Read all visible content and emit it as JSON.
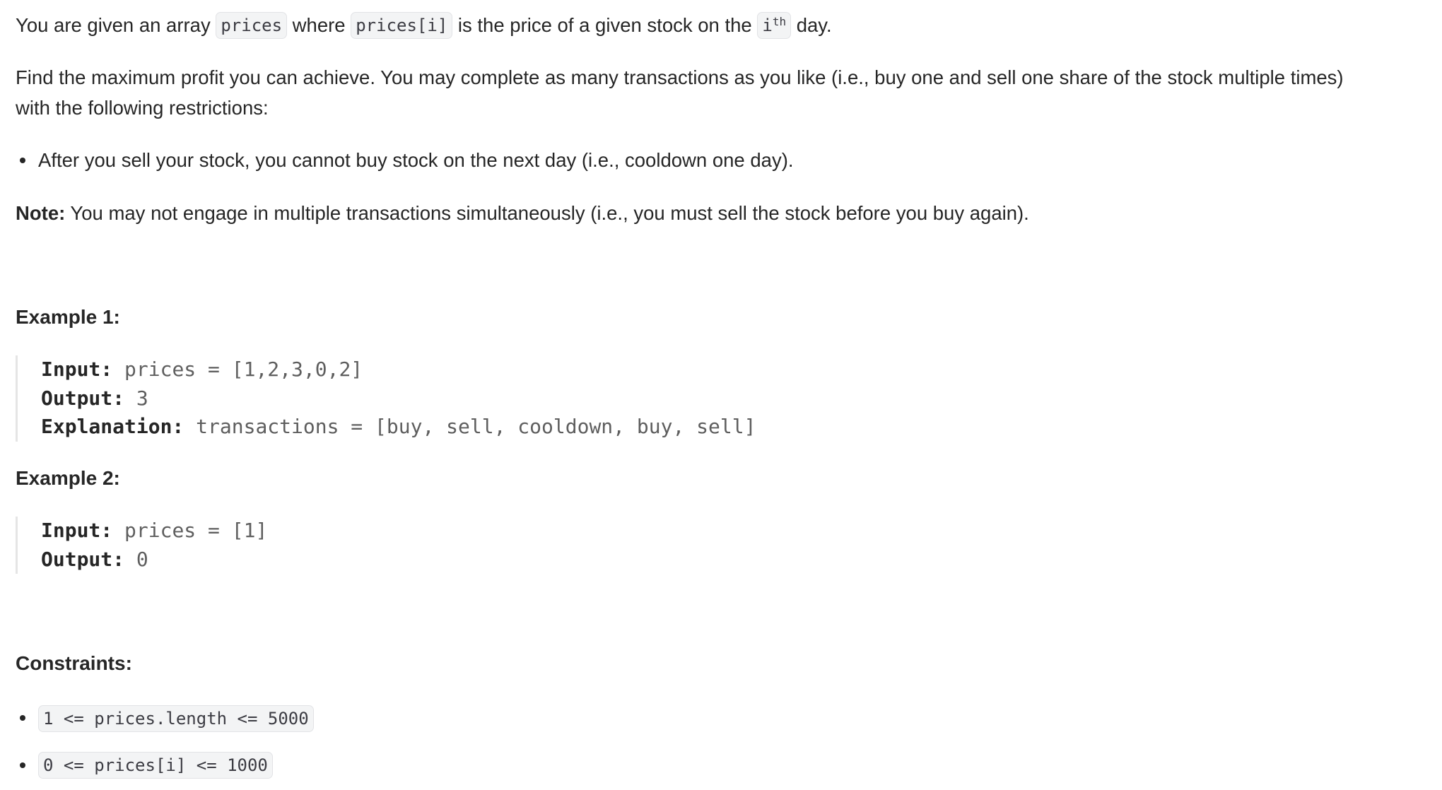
{
  "intro": {
    "t1": "You are given an array ",
    "c1": "prices",
    "t2": " where ",
    "c2": "prices[i]",
    "t3": " is the price of a given stock on the ",
    "c3_base": "i",
    "c3_sup": "th",
    "t4": " day."
  },
  "para2": {
    "line1": "Find the maximum profit you can achieve. You may complete as many transactions as you like (i.e., buy one and sell one share of the stock multiple times)",
    "line2": "with the following restrictions:"
  },
  "restrictions": [
    "After you sell your stock, you cannot buy stock on the next day (i.e., cooldown one day)."
  ],
  "note": {
    "label": "Note:",
    "text": " You may not engage in multiple transactions simultaneously (i.e., you must sell the stock before you buy again)."
  },
  "examples": [
    {
      "title": "Example 1:",
      "input_label": "Input:",
      "input_value": " prices = [1,2,3,0,2]",
      "output_label": "Output:",
      "output_value": " 3",
      "explanation_label": "Explanation:",
      "explanation_value": " transactions = [buy, sell, cooldown, buy, sell]"
    },
    {
      "title": "Example 2:",
      "input_label": "Input:",
      "input_value": " prices = [1]",
      "output_label": "Output:",
      "output_value": " 0"
    }
  ],
  "constraints": {
    "title": "Constraints:",
    "items": [
      "1 <= prices.length <= 5000",
      "0 <= prices[i] <= 1000"
    ]
  }
}
